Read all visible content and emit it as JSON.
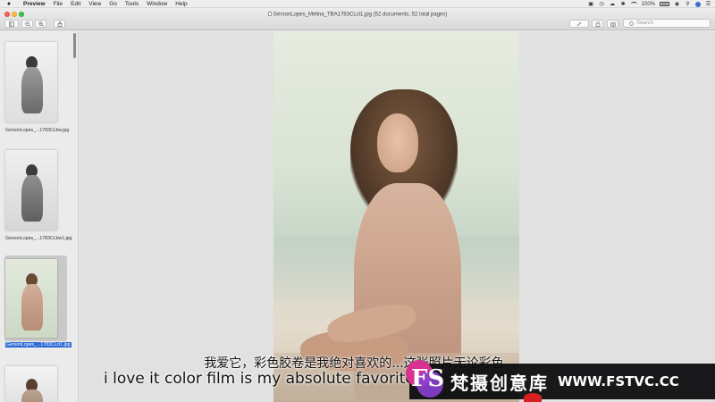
{
  "menubar": {
    "app_name": "Preview",
    "items": [
      "File",
      "Edit",
      "View",
      "Go",
      "Tools",
      "Window",
      "Help"
    ],
    "battery": "100%"
  },
  "window": {
    "title": "GersonLopes_Melina_TBA1783CLcl1.jpg (52 documents, 52 total pages)",
    "search_placeholder": "Search"
  },
  "sidebar": {
    "thumbnails": [
      {
        "label": "GersonLopes_...1783CLbw.jpg",
        "selected": false,
        "tone": "bw"
      },
      {
        "label": "GersonLopes_...1783CLbw1.jpg",
        "selected": false,
        "tone": "bw"
      },
      {
        "label": "GersonLopes_...1783CLcl1.jpg",
        "selected": true,
        "tone": "color"
      }
    ]
  },
  "subtitles": {
    "chinese": "我爱它，彩色胶卷是我绝对喜欢的...这张照片无论彩色",
    "english": "i love it color film is my absolute favorite t"
  },
  "watermark": {
    "logo_text": "FS",
    "brand_cn": "梵摄创意库",
    "url": "WWW.FSTVC.CC"
  },
  "colors": {
    "selection": "#2a68d6",
    "watermark_pink": "#d7328f",
    "watermark_purple": "#8a3fd0"
  }
}
